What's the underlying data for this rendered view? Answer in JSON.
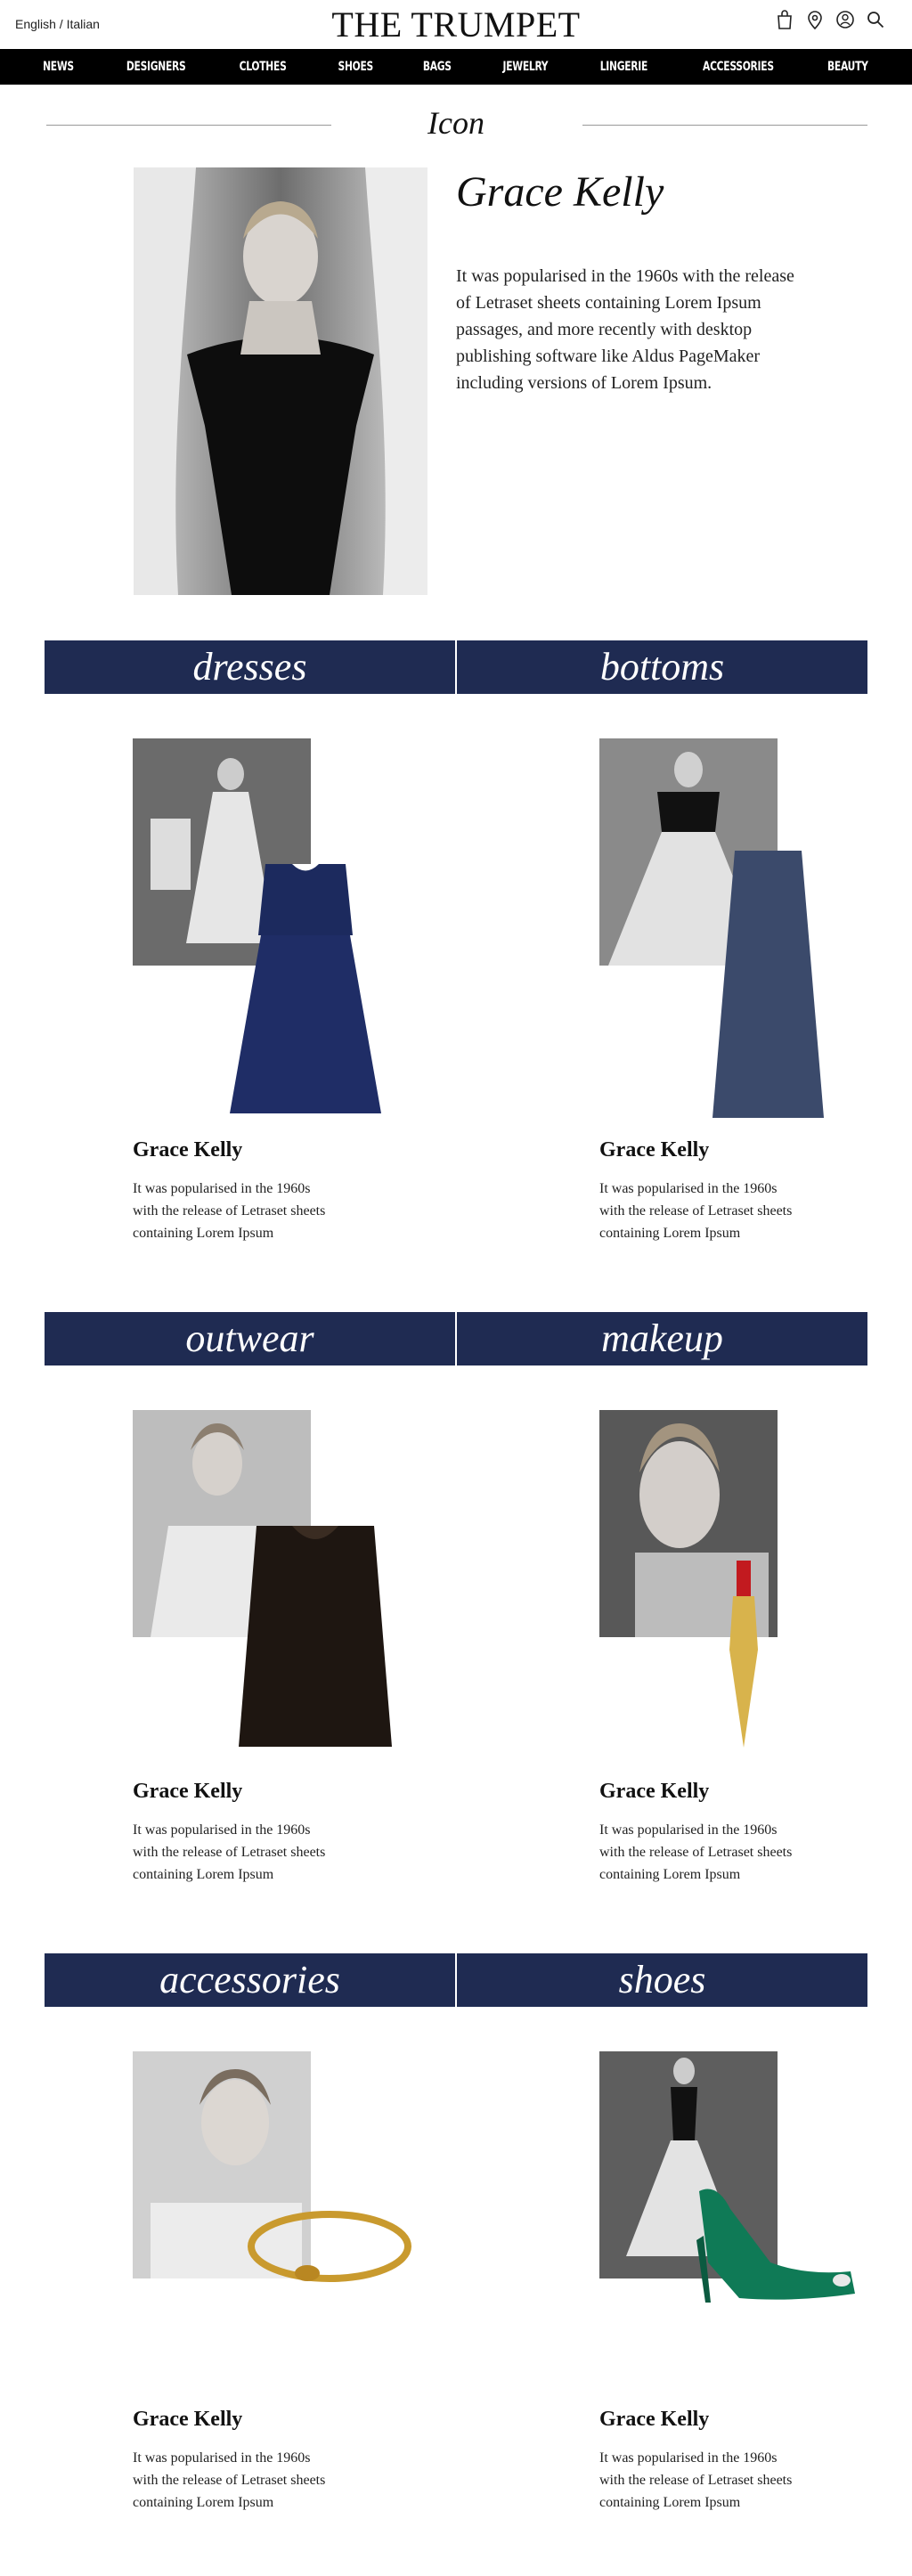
{
  "header": {
    "language": "English / Italian",
    "logo": "THE TRUMPET",
    "icons": [
      "bag-icon",
      "location-icon",
      "account-icon",
      "search-icon"
    ]
  },
  "nav": [
    "NEWS",
    "DESIGNERS",
    "CLOTHES",
    "SHOES",
    "BAGS",
    "JEWELRY",
    "LINGERIE",
    "ACCESSORIES",
    "BEAUTY"
  ],
  "icon_section": {
    "title": "Icon",
    "name": "Grace Kelly",
    "text": "It was popularised in the 1960s with the release of Letraset sheets containing Lorem Ipsum passages, and more recently with desktop publishing software like Aldus PageMaker including versions of Lorem Ipsum."
  },
  "categories": [
    {
      "left": "dresses",
      "right": "bottoms"
    },
    {
      "left": "outwear",
      "right": "makeup"
    },
    {
      "left": "accessories",
      "right": "shoes"
    }
  ],
  "cards": [
    {
      "name": "Grace Kelly",
      "text": "It was popularised in the 1960s with the release of Letraset sheets containing Lorem Ipsum",
      "product": "navy lace dress"
    },
    {
      "name": "Grace Kelly",
      "text": "It was popularised in the 1960s with the release of Letraset sheets containing Lorem Ipsum",
      "product": "navy tulle skirt"
    },
    {
      "name": "Grace Kelly",
      "text": "It was popularised in the 1960s with the release of Letraset sheets containing Lorem Ipsum",
      "product": "fur vest"
    },
    {
      "name": "Grace Kelly",
      "text": "It was popularised in the 1960s with the release of Letraset sheets containing Lorem Ipsum",
      "product": "gold lipstick"
    },
    {
      "name": "Grace Kelly",
      "text": "It was popularised in the 1960s with the release of Letraset sheets containing Lorem Ipsum",
      "product": "gold bracelet"
    },
    {
      "name": "Grace Kelly",
      "text": "It was popularised in the 1960s with the release of Letraset sheets containing Lorem Ipsum",
      "product": "green satin pump"
    }
  ],
  "colors": {
    "nav_bg": "#000000",
    "bar_bg": "#1f2b52",
    "text": "#111111"
  }
}
